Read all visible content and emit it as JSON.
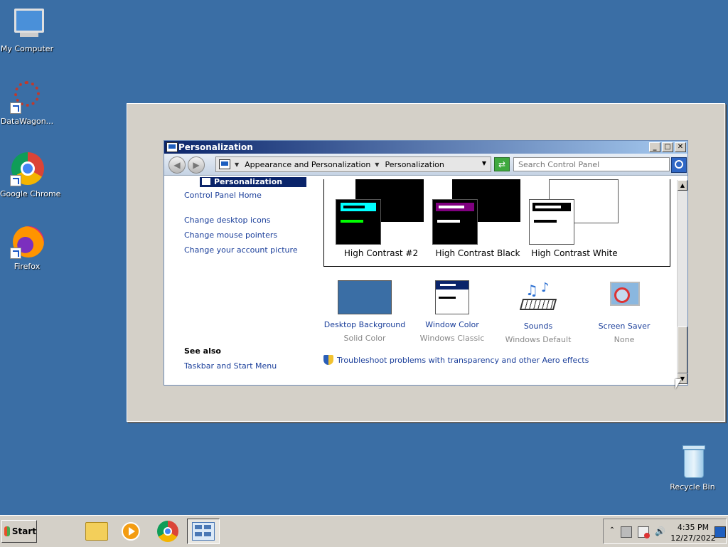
{
  "desktop": {
    "icons": [
      {
        "label": "My Computer"
      },
      {
        "label": "DataWagon..."
      },
      {
        "label": "Google Chrome"
      },
      {
        "label": "Firefox"
      },
      {
        "label": "Recycle Bin"
      }
    ]
  },
  "window": {
    "title": "Personalization",
    "controls": {
      "minimize": "_",
      "maximize": "□",
      "close": "✕"
    },
    "nav": {
      "back": "◀",
      "forward": "▶",
      "breadcrumb": [
        "Appearance and Personalization",
        "Personalization"
      ],
      "search_placeholder": "Search Control Panel"
    },
    "dropdown_highlight": "Personalization",
    "left_pane": {
      "home": "Control Panel Home",
      "links": [
        "Change desktop icons",
        "Change mouse pointers",
        "Change your account picture"
      ],
      "see_also_title": "See also",
      "see_also_links": [
        "Taskbar and Start Menu"
      ]
    },
    "themes": [
      {
        "name": "High Contrast #2",
        "back": "#000000",
        "front_bg": "#000000",
        "bar1": "#00ffff",
        "bar2": "#00ff00"
      },
      {
        "name": "High Contrast Black",
        "back": "#000000",
        "front_bg": "#000000",
        "bar1": "#800080",
        "bar2": "#ffffff"
      },
      {
        "name": "High Contrast White",
        "back": "#ffffff",
        "front_bg": "#ffffff",
        "bar1": "#000000",
        "bar2": "#000000"
      }
    ],
    "settings": [
      {
        "name": "Desktop Background",
        "value": "Solid Color"
      },
      {
        "name": "Window Color",
        "value": "Windows Classic"
      },
      {
        "name": "Sounds",
        "value": "Windows Default"
      },
      {
        "name": "Screen Saver",
        "value": "None"
      }
    ],
    "troubleshoot": "Troubleshoot problems with transparency and other Aero effects"
  },
  "taskbar": {
    "start_label": "Start",
    "clock_time": "4:35 PM",
    "clock_date": "12/27/2022"
  },
  "colors": {
    "desktop": "#3a6ea5",
    "link": "#1a3e9a",
    "titlebar": "#0a246a"
  }
}
